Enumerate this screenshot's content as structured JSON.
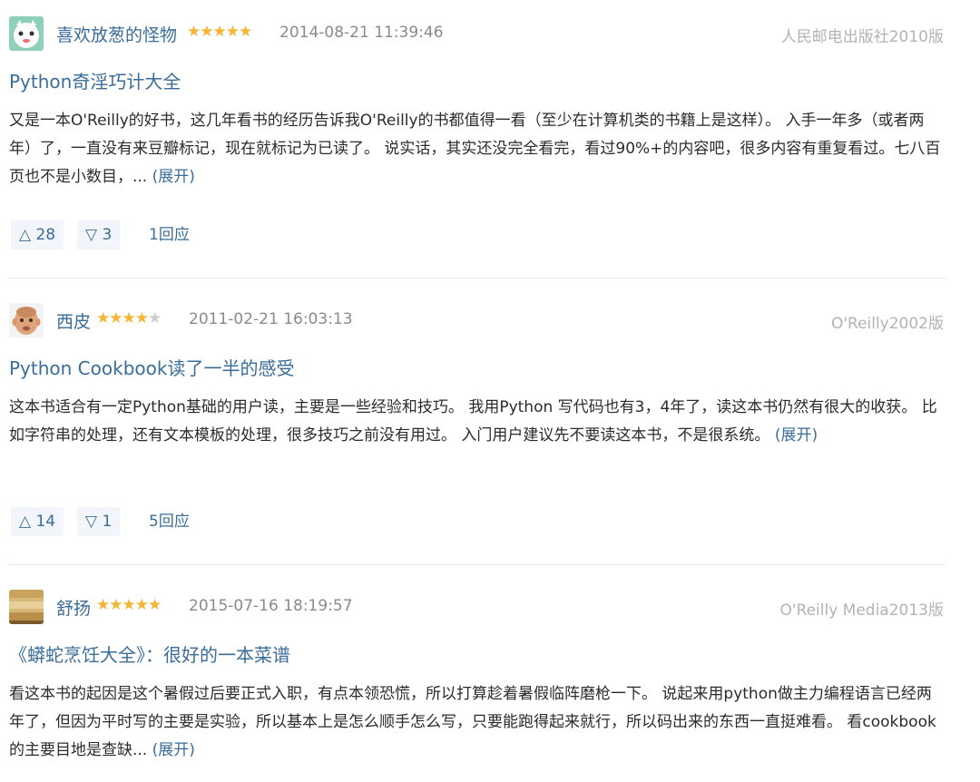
{
  "reviews": [
    {
      "author": "喜欢放葱的怪物",
      "stars": "★★★★★",
      "stars_off": "",
      "date": "2014-08-21 11:39:46",
      "edition": "人民邮电出版社2010版",
      "title": "Python奇淫巧计大全",
      "body": "又是一本O'Reilly的好书，这几年看书的经历告诉我O'Reilly的书都值得一看（至少在计算机类的书籍上是这样）。 入手一年多（或者两年）了，一直没有来豆瓣标记，现在就标记为已读了。 说实话，其实还没完全看完，看过90%+的内容吧，很多内容有重复看过。七八百页也不是小数目，... ",
      "expand": "(展开)",
      "up": "△ 28",
      "down": "▽ 3",
      "replies": "1回应"
    },
    {
      "author": "西皮",
      "stars": "★★★★",
      "stars_off": "★",
      "date": "2011-02-21 16:03:13",
      "edition": "O'Reilly2002版",
      "title": "Python Cookbook读了一半的感受",
      "body": "这本书适合有一定Python基础的用户读，主要是一些经验和技巧。 我用Python 写代码也有3，4年了，读这本书仍然有很大的收获。 比如字符串的处理，还有文本模板的处理，很多技巧之前没有用过。 入门用户建议先不要读这本书，不是很系统。 ",
      "expand": "(展开)",
      "up": "△ 14",
      "down": "▽ 1",
      "replies": "5回应"
    },
    {
      "author": "舒扬",
      "stars": "★★★★★",
      "stars_off": "",
      "date": "2015-07-16 18:19:57",
      "edition": "O'Reilly Media2013版",
      "title": "《蟒蛇烹饪大全》：很好的一本菜谱",
      "body": "看这本书的起因是这个暑假过后要正式入职，有点本领恐慌，所以打算趁着暑假临阵磨枪一下。 说起来用python做主力编程语言已经两年了，但因为平时写的主要是实验，所以基本上是怎么顺手怎么写，只要能跑得起来就行，所以码出来的东西一直挺难看。 看cookbook的主要目地是查缺... ",
      "expand": "(展开)"
    }
  ]
}
